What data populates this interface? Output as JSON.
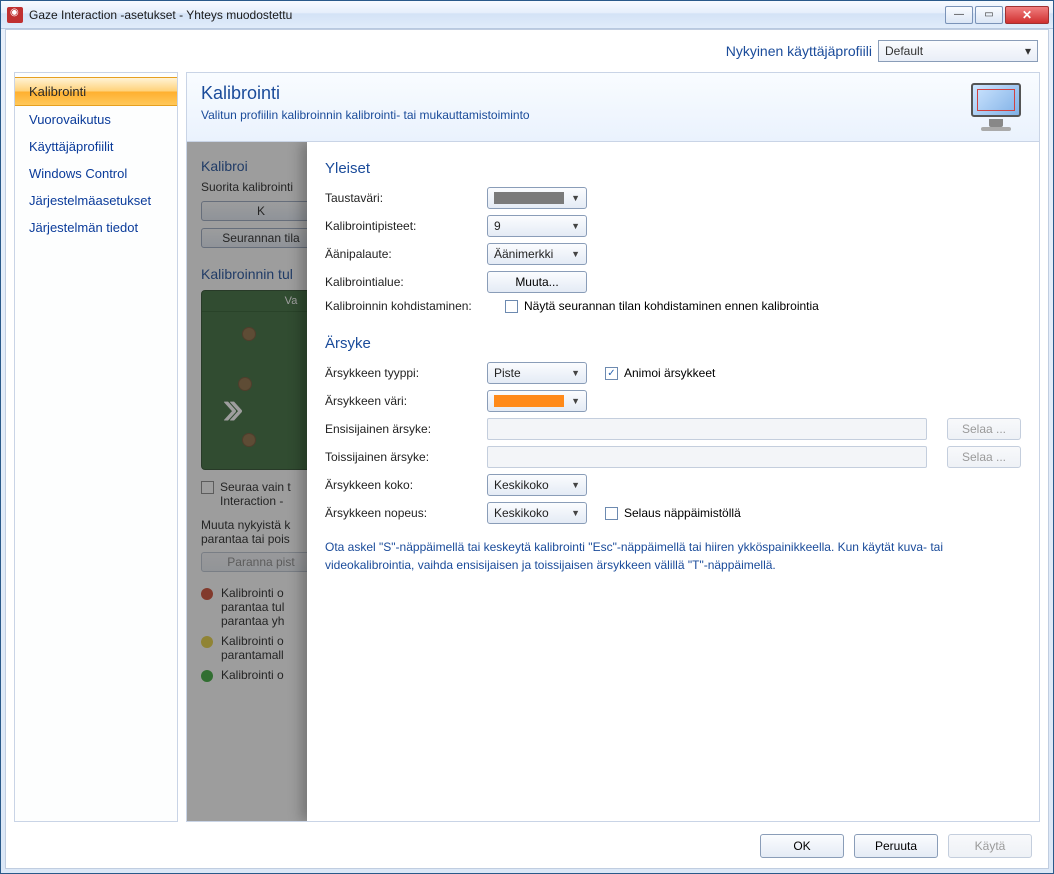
{
  "window": {
    "title": "Gaze Interaction -asetukset - Yhteys muodostettu"
  },
  "profilebar": {
    "label": "Nykyinen käyttäjäprofiili",
    "selected": "Default"
  },
  "sidebar": {
    "items": [
      {
        "label": "Kalibrointi",
        "active": true
      },
      {
        "label": "Vuorovaikutus"
      },
      {
        "label": "Käyttäjäprofiilit"
      },
      {
        "label": "Windows Control"
      },
      {
        "label": "Järjestelmäasetukset"
      },
      {
        "label": "Järjestelmän tiedot"
      }
    ]
  },
  "header": {
    "title": "Kalibrointi",
    "subtitle": "Valitun profiilin kalibroinnin kalibrointi- tai mukauttamistoiminto"
  },
  "under": {
    "s1_title": "Kalibroi",
    "s1_text": "Suorita kalibrointi",
    "s1_btn1": "K",
    "s1_btn2": "Seurannan tila",
    "s2_title": "Kalibroinnin tul",
    "preview_hd": "Va",
    "chk_text": "Seuraa vain t\nInteraction -",
    "s3_text": "Muuta nykyistä k\nparantaa tai pois",
    "s3_btn": "Paranna pist",
    "legend": [
      {
        "color": "#cc4a30",
        "text": "Kalibrointi o\nparantaa tul\nparantaa yh"
      },
      {
        "color": "#e6d040",
        "text": "Kalibrointi o\nparantamall"
      },
      {
        "color": "#3aa83a",
        "text": "Kalibrointi o"
      }
    ]
  },
  "overlay": {
    "general_title": "Yleiset",
    "rows": {
      "bg_label": "Taustaväri:",
      "points_label": "Kalibrointipisteet:",
      "points_value": "9",
      "sound_label": "Äänipalaute:",
      "sound_value": "Äänimerkki",
      "area_label": "Kalibrointialue:",
      "area_btn": "Muuta...",
      "target_label": "Kalibroinnin kohdistaminen:",
      "target_chk_text": "Näytä seurannan tilan kohdistaminen ennen kalibrointia"
    },
    "stimulus_title": "Ärsyke",
    "stim": {
      "type_label": "Ärsykkeen tyyppi:",
      "type_value": "Piste",
      "animate_chk": "Animoi ärsykkeet",
      "color_label": "Ärsykkeen väri:",
      "primary_label": "Ensisijainen ärsyke:",
      "secondary_label": "Toissijainen ärsyke:",
      "browse": "Selaa ...",
      "size_label": "Ärsykkeen koko:",
      "size_value": "Keskikoko",
      "speed_label": "Ärsykkeen nopeus:",
      "speed_value": "Keskikoko",
      "kbd_chk": "Selaus näppäimistöllä"
    },
    "help": "Ota askel \"S\"-näppäimellä tai keskeytä kalibrointi \"Esc\"-näppäimellä tai hiiren ykköspainikkeella. Kun käytät kuva- tai videokalibrointia, vaihda ensisijaisen ja toissijaisen ärsykkeen välillä \"T\"-näppäimellä."
  },
  "footer": {
    "ok": "OK",
    "cancel": "Peruuta",
    "apply": "Käytä"
  }
}
